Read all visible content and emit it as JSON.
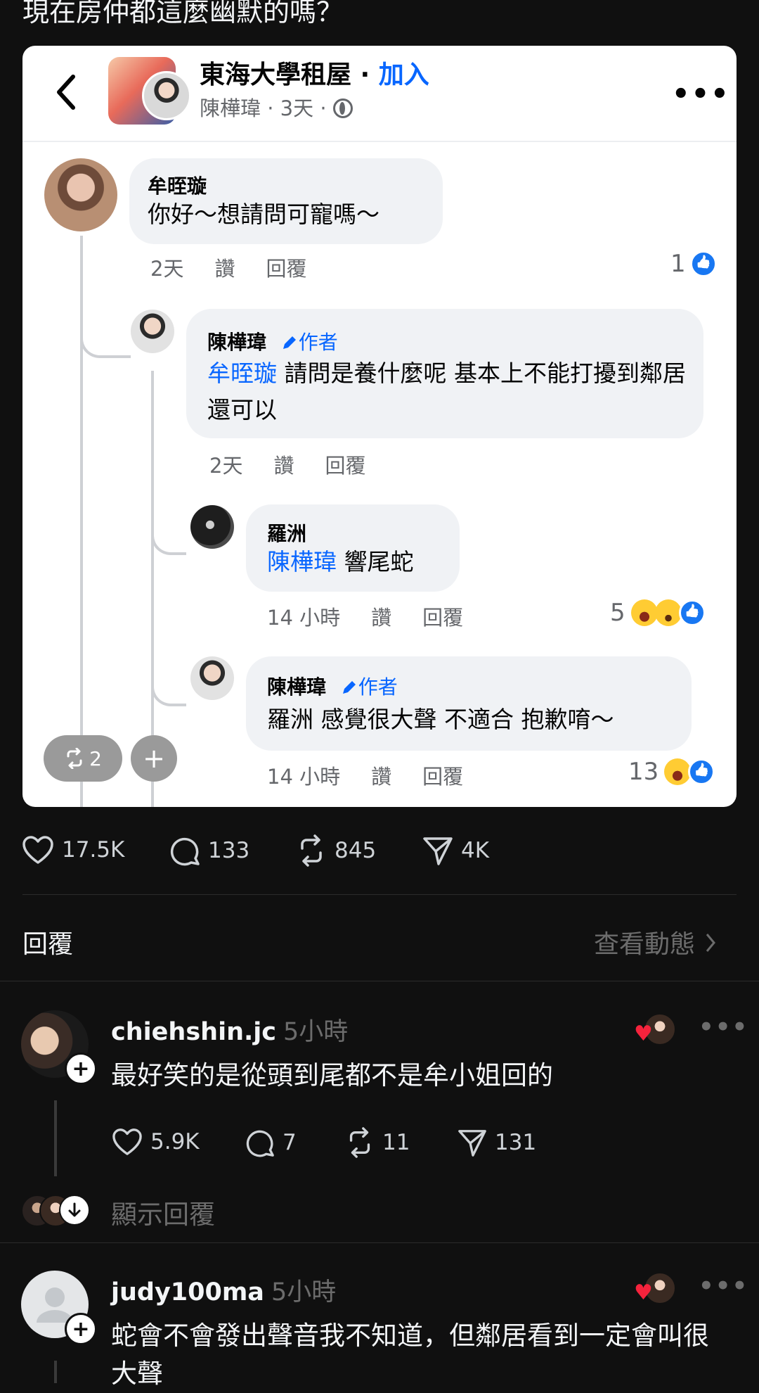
{
  "post": {
    "text": "現在房仲都這麼幽默的嗎？"
  },
  "fb": {
    "group_name": "東海大學租屋",
    "join_separator": " · ",
    "join_label": "加入",
    "author_line": "陳樺瑋 · 3天 ·",
    "comments": [
      {
        "name": "牟晊璇",
        "text": "你好～想請問可寵嗎～",
        "time": "2天",
        "like": "讚",
        "reply": "回覆",
        "reaction_count": "1"
      },
      {
        "name": "陳樺瑋",
        "badge": "作者",
        "mention": "牟晊璇",
        "text": " 請問是養什麼呢 基本上不能打擾到鄰居還可以",
        "time": "2天",
        "like": "讚",
        "reply": "回覆"
      },
      {
        "name": "羅洲",
        "mention": "陳樺瑋",
        "text": " 響尾蛇",
        "time": "14 小時",
        "like": "讚",
        "reply": "回覆",
        "reaction_count": "5"
      },
      {
        "name": "陳樺瑋",
        "badge": "作者",
        "text": "羅洲 感覺很大聲 不適合 抱歉唷～",
        "time": "14 小時",
        "like": "讚",
        "reply": "回覆",
        "reaction_count": "13"
      }
    ]
  },
  "overlay": {
    "repost_count": "2"
  },
  "stats": {
    "likes": "17.5K",
    "comments": "133",
    "reposts": "845",
    "shares": "4K"
  },
  "replies_section": {
    "title": "回覆",
    "link": "查看動態"
  },
  "replies": [
    {
      "user": "chiehshin.jc",
      "time": "5小時",
      "text": "最好笑的是從頭到尾都不是牟小姐回的",
      "likes": "5.9K",
      "comments": "7",
      "reposts": "11",
      "shares": "131",
      "show_replies": "顯示回覆"
    },
    {
      "user": "judy100ma",
      "time": "5小時",
      "text": "蛇會不會發出聲音我不知道，但鄰居看到一定會叫很大聲"
    }
  ],
  "icons": [
    "back-arrow-icon",
    "globe-icon",
    "more-icon",
    "pencil-icon",
    "like-reaction-icon",
    "haha-reaction-icon",
    "wow-reaction-icon",
    "repost-icon",
    "plus-icon",
    "heart-icon",
    "comment-icon",
    "share-icon",
    "chevron-right-icon",
    "arrow-down-icon"
  ]
}
